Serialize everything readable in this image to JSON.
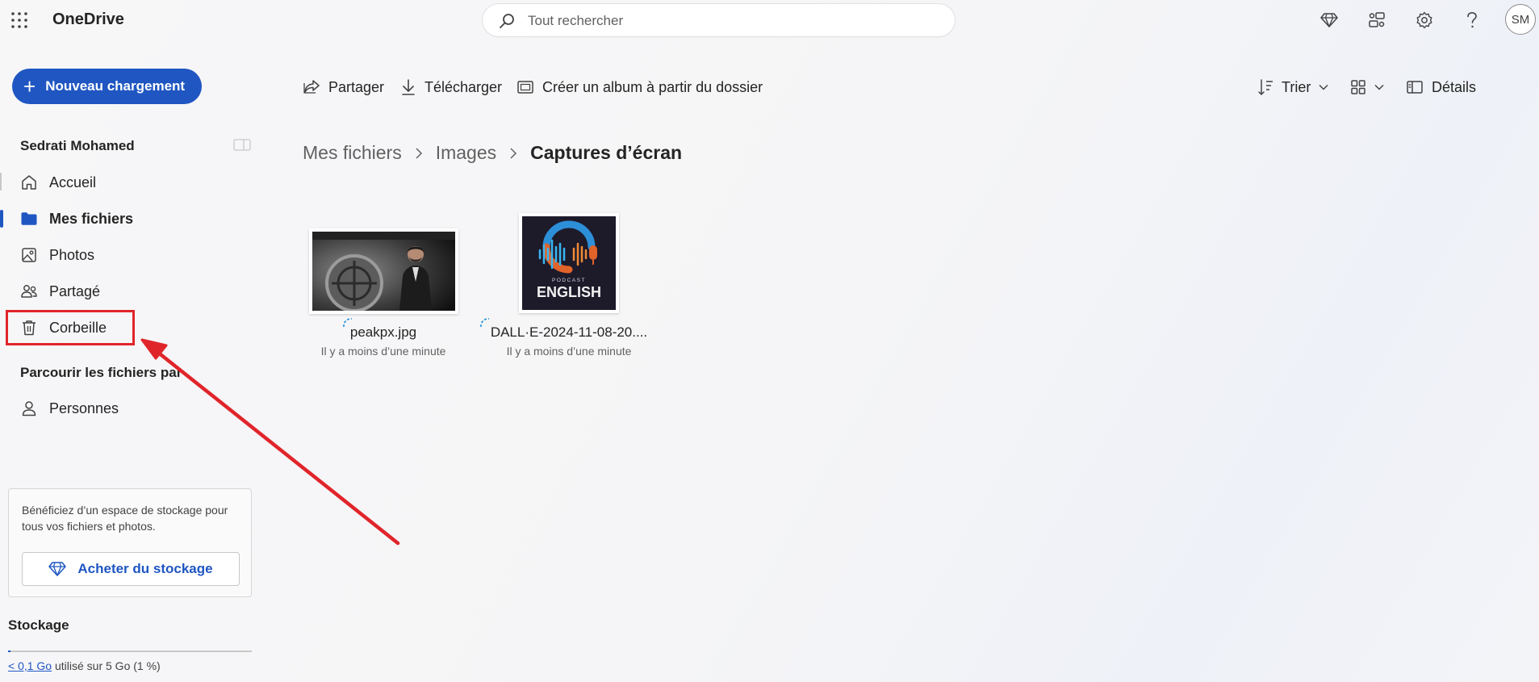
{
  "app": {
    "title": "OneDrive",
    "accent_color": "#1f56c2"
  },
  "header": {
    "search_placeholder": "Tout rechercher",
    "icons": [
      "premium-diamond-icon",
      "share-network-icon",
      "settings-gear-icon",
      "help-icon"
    ],
    "avatar_initials": "SM"
  },
  "new_button": {
    "label": "Nouveau chargement"
  },
  "commands": {
    "share": "Partager",
    "download": "Télécharger",
    "create_album": "Créer un album à partir du dossier",
    "sort": "Trier",
    "details": "Détails"
  },
  "sidebar": {
    "user_name": "Sedrati Mohamed",
    "items": [
      {
        "label": "Accueil",
        "icon": "home-icon"
      },
      {
        "label": "Mes fichiers",
        "icon": "folder-icon",
        "active": true
      },
      {
        "label": "Photos",
        "icon": "photo-icon"
      },
      {
        "label": "Partagé",
        "icon": "people-icon"
      },
      {
        "label": "Corbeille",
        "icon": "trash-icon",
        "highlighted": true
      }
    ],
    "browse_label": "Parcourir les fichiers par",
    "browse_items": [
      {
        "label": "Personnes",
        "icon": "person-icon"
      }
    ],
    "promo_text": "Bénéficiez d’un espace de stockage pour tous vos fichiers et photos.",
    "buy_storage": "Acheter du stockage",
    "storage_title": "Stockage",
    "storage_used": "< 0,1 Go",
    "storage_rest": " utilisé sur 5 Go (1 %)",
    "storage_fraction": 0.01
  },
  "breadcrumb": {
    "items": [
      "Mes fichiers",
      "Images"
    ],
    "current": "Captures d’écran"
  },
  "files": [
    {
      "name": "peakpx.jpg",
      "modified": "Il y a moins d’une minute"
    },
    {
      "name": "DALL·E-2024-11-08-20....",
      "modified": "Il y a moins d’une minute"
    }
  ],
  "podcast_thumbnail": {
    "small_text": "PODCAST",
    "big_text": "ENGLISH"
  },
  "annotation": {
    "color": "#e0252a"
  }
}
